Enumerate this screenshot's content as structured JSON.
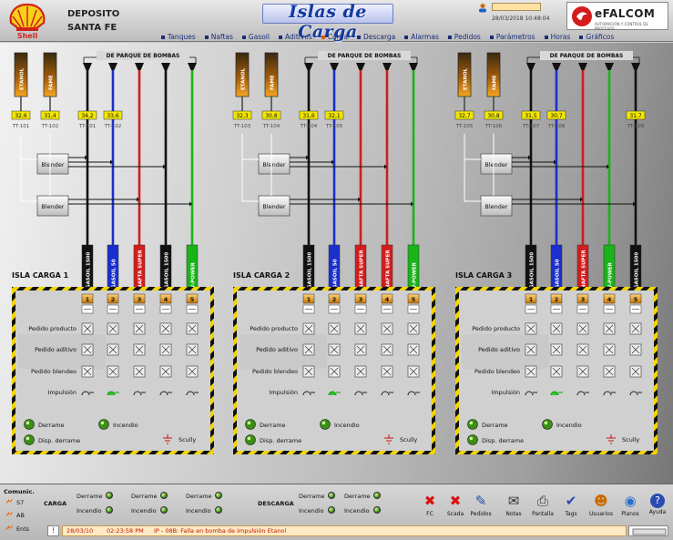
{
  "header": {
    "company": "Shell",
    "site_line1": "DEPOSITO",
    "site_line2": "SANTA FE",
    "title": "Islas de Carga",
    "datetime": "28/03/2018  10:48:04",
    "vendor": "eFALCOM",
    "vendor_sub": "AUTOMACIÓN Y CONTROL DE PROCESOS"
  },
  "nav": [
    {
      "label": "Tanques",
      "active": false
    },
    {
      "label": "Naftas",
      "active": false
    },
    {
      "label": "Gasoil",
      "active": false
    },
    {
      "label": "Aditivos",
      "active": false
    },
    {
      "label": "Carga",
      "active": true
    },
    {
      "label": "Descarga",
      "active": false
    },
    {
      "label": "Alarmas",
      "active": false
    },
    {
      "label": "Pedidos",
      "active": false
    },
    {
      "label": "Parámetros",
      "active": false
    },
    {
      "label": "Horas",
      "active": false
    },
    {
      "label": "Gráficos",
      "active": false
    }
  ],
  "labels": {
    "pump_park": "DE PARQUE DE BOMBAS",
    "blender": "Blender",
    "pedido_producto": "Pedido producto",
    "pedido_aditivo": "Pedido aditivo",
    "pedido_blendeo": "Pedido blendeo",
    "impulsion": "Impulsión",
    "derrame": "Derrame",
    "incendio": "Incendio",
    "disp_derrame": "Disp. derrame",
    "scully": "Scully"
  },
  "islands": [
    {
      "name": "ISLA CARGA 1",
      "tanks": [
        {
          "name": "ETANOL",
          "value": "32,6",
          "tag": "TT-101"
        },
        {
          "name": "FAME",
          "value": "31,4",
          "tag": "TT-102"
        }
      ],
      "pipes": [
        {
          "value": "34,2",
          "tag": "TT-101",
          "color": "#111111"
        },
        {
          "value": "33,6",
          "tag": "TT-102",
          "color": "#1a2fcc"
        },
        {
          "value": "",
          "tag": "",
          "color": "#d41c1c"
        },
        {
          "value": "",
          "tag": "",
          "color": "#111111"
        },
        {
          "value": "",
          "tag": "",
          "color": "#18b418"
        }
      ],
      "arms": [
        {
          "label": "GASOIL 1500",
          "color": "#111111",
          "num": "1"
        },
        {
          "label": "GASOIL 50",
          "color": "#1a2fcc",
          "num": "2"
        },
        {
          "label": "NAFTA SUPER",
          "color": "#d41c1c",
          "num": "3"
        },
        {
          "label": "GASOIL 1500",
          "color": "#111111",
          "num": "4"
        },
        {
          "label": "V-POWER",
          "color": "#18b418",
          "num": "5"
        }
      ]
    },
    {
      "name": "ISLA CARGA 2",
      "tanks": [
        {
          "name": "ETANOL",
          "value": "32,3",
          "tag": "TT-103"
        },
        {
          "name": "FAME",
          "value": "30,8",
          "tag": "TT-104"
        }
      ],
      "pipes": [
        {
          "value": "31,6",
          "tag": "TT-104",
          "color": "#111111"
        },
        {
          "value": "32,1",
          "tag": "TT-105",
          "color": "#1a2fcc"
        },
        {
          "value": "",
          "tag": "",
          "color": "#d41c1c"
        },
        {
          "value": "",
          "tag": "",
          "color": "#d41c1c"
        },
        {
          "value": "",
          "tag": "",
          "color": "#18b418"
        }
      ],
      "arms": [
        {
          "label": "GASOIL 1500",
          "color": "#111111",
          "num": "1"
        },
        {
          "label": "GASOIL 50",
          "color": "#1a2fcc",
          "num": "2"
        },
        {
          "label": "NAFTA SUPER",
          "color": "#d41c1c",
          "num": "3"
        },
        {
          "label": "NAFTA SUPER",
          "color": "#d41c1c",
          "num": "4"
        },
        {
          "label": "V-POWER",
          "color": "#18b418",
          "num": "5"
        }
      ]
    },
    {
      "name": "ISLA CARGA 3",
      "tanks": [
        {
          "name": "ETANOL",
          "value": "32,7",
          "tag": "TT-105"
        },
        {
          "name": "FAME",
          "value": "30,8",
          "tag": "TT-106"
        }
      ],
      "pipes": [
        {
          "value": "31,5",
          "tag": "TT-107",
          "color": "#111111"
        },
        {
          "value": "30,7",
          "tag": "TT-108",
          "color": "#1a2fcc"
        },
        {
          "value": "",
          "tag": "",
          "color": "#d41c1c"
        },
        {
          "value": "",
          "tag": "",
          "color": "#18b418"
        },
        {
          "value": "31,7",
          "tag": "TT-109",
          "color": "#111111"
        }
      ],
      "arms": [
        {
          "label": "GASOIL 1500",
          "color": "#111111",
          "num": "1"
        },
        {
          "label": "GASOIL 50",
          "color": "#1a2fcc",
          "num": "2"
        },
        {
          "label": "NAFTA SUPER",
          "color": "#d41c1c",
          "num": "3"
        },
        {
          "label": "V-POWER",
          "color": "#18b418",
          "num": "4"
        },
        {
          "label": "GASOIL 1500",
          "color": "#111111",
          "num": "5"
        }
      ]
    }
  ],
  "bottom": {
    "comunic_label": "Comunic.",
    "comm": [
      "S7",
      "AB",
      "Ents"
    ],
    "carga_label": "CARGA",
    "descarga_label": "DESCARGA",
    "derrame": "Derrame",
    "incendio": "Incendio",
    "alarm_date": "28/03/10",
    "alarm_time": "02:23:58 PM",
    "alarm_text": "IP - 08B: Falla en bomba de impulsión Etanol"
  },
  "tools": [
    {
      "label": "FC",
      "icon": "x-icon"
    },
    {
      "label": "Scada",
      "icon": "x-icon"
    },
    {
      "label": "Pedidos",
      "icon": "pencil-icon"
    },
    {
      "label": "Notas",
      "icon": "notes-icon"
    },
    {
      "label": "Pantalla",
      "icon": "printer-icon"
    },
    {
      "label": "Tags",
      "icon": "tags-icon"
    },
    {
      "label": "Usuarios",
      "icon": "users-icon"
    },
    {
      "label": "Planos",
      "icon": "globe-icon"
    },
    {
      "label": "Ayuda",
      "icon": "help-icon"
    }
  ]
}
